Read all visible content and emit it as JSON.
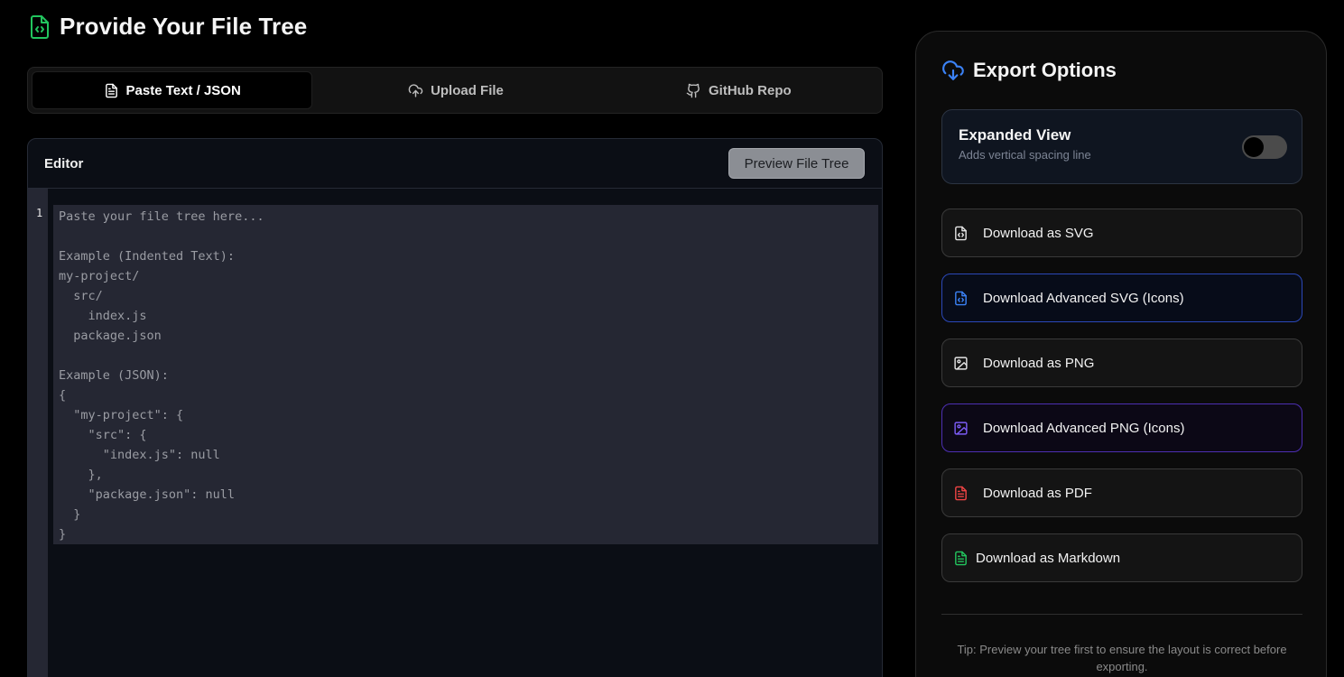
{
  "header": {
    "title": "Provide Your File Tree",
    "icon": "file-code-icon",
    "icon_color": "#22c55e"
  },
  "tabs": [
    {
      "label": "Paste Text / JSON",
      "icon": "file-text-icon",
      "active": true
    },
    {
      "label": "Upload File",
      "icon": "cloud-upload-icon",
      "active": false
    },
    {
      "label": "GitHub Repo",
      "icon": "github-icon",
      "active": false
    }
  ],
  "editor": {
    "label": "Editor",
    "preview_button": "Preview File Tree",
    "line_number": "1",
    "placeholder": "Paste your file tree here...\n\nExample (Indented Text):\nmy-project/\n  src/\n    index.js\n  package.json\n\nExample (JSON):\n{\n  \"my-project\": {\n    \"src\": {\n      \"index.js\": null\n    },\n    \"package.json\": null\n  }\n}"
  },
  "export": {
    "title": "Export Options",
    "icon": "cloud-download-icon",
    "icon_color": "#3b82f6",
    "expanded_view": {
      "title": "Expanded View",
      "subtitle": "Adds vertical spacing line",
      "enabled": false
    },
    "buttons": [
      {
        "label": "Download as SVG",
        "icon": "file-code-icon",
        "color": "#e5e5e5"
      },
      {
        "label": "Download Advanced SVG (Icons)",
        "icon": "file-code-icon",
        "color": "#3b82f6"
      },
      {
        "label": "Download as PNG",
        "icon": "image-icon",
        "color": "#e5e5e5"
      },
      {
        "label": "Download Advanced PNG (Icons)",
        "icon": "image-icon",
        "color": "#7c5cf6"
      },
      {
        "label": "Download as PDF",
        "icon": "file-text-icon",
        "color": "#ef4444"
      },
      {
        "label": "Download as Markdown",
        "icon": "file-text-icon",
        "color": "#22c55e"
      }
    ],
    "tip": "Tip: Preview your tree first to ensure the layout is correct before exporting."
  }
}
